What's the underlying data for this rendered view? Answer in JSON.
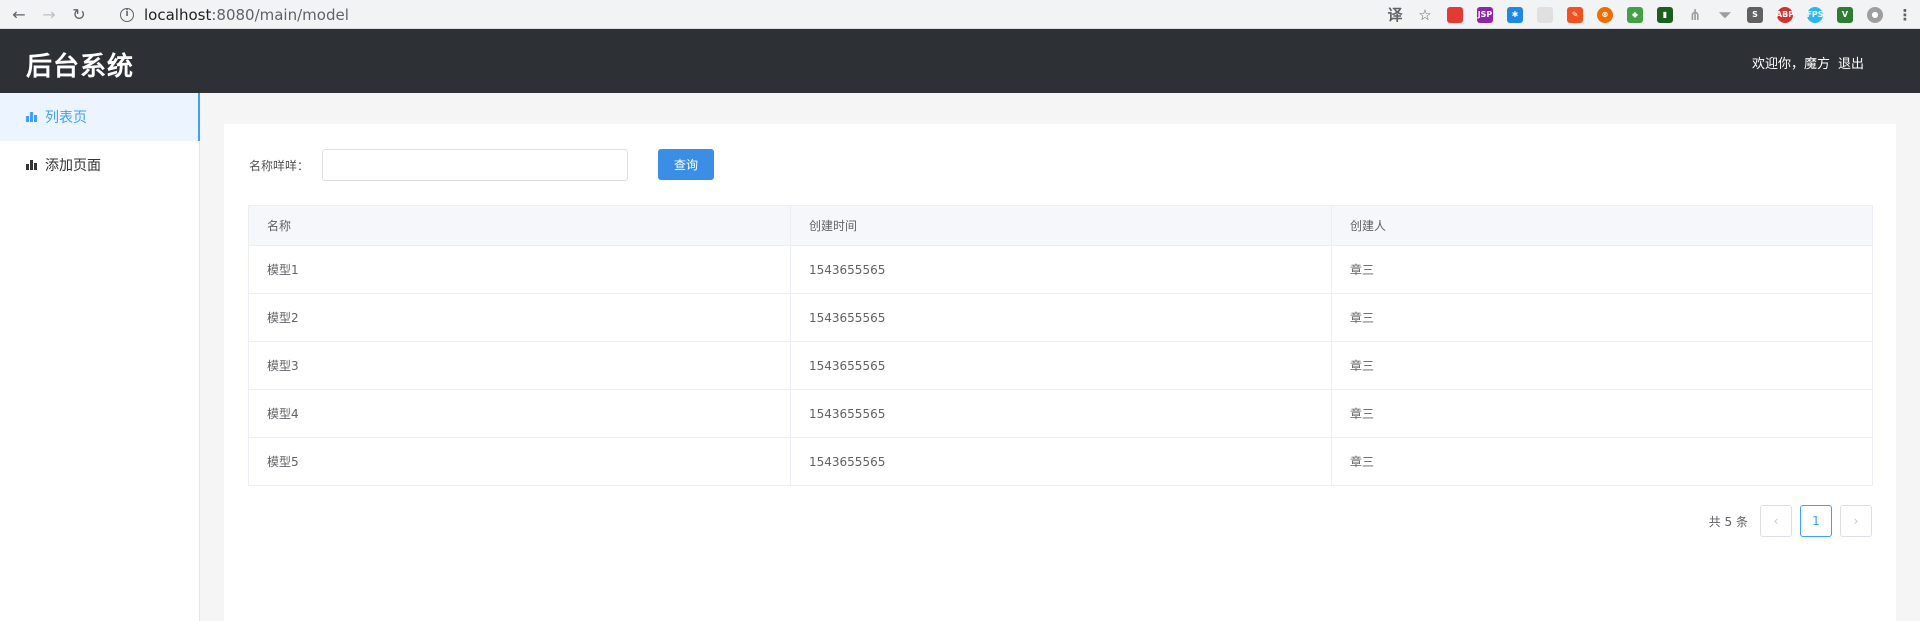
{
  "browser": {
    "url_host": "localhost",
    "url_path": ":8080/main/model",
    "extensions": [
      {
        "name": "translate-icon",
        "color": "#5f6368",
        "glyph": "译"
      },
      {
        "name": "star-icon",
        "color": "#5f6368",
        "glyph": "☆"
      },
      {
        "name": "ext-red-icon",
        "color": "#e53935",
        "glyph": ""
      },
      {
        "name": "ext-purple-icon",
        "color": "#8e24aa",
        "glyph": "JSP"
      },
      {
        "name": "ext-asterisk-icon",
        "color": "#1e88e5",
        "glyph": "✱"
      },
      {
        "name": "ext-blank-icon",
        "color": "#e0e0e0",
        "glyph": ""
      },
      {
        "name": "ext-orange-icon",
        "color": "#f4511e",
        "glyph": "✎"
      },
      {
        "name": "ext-orange-round-icon",
        "color": "#ef6c00",
        "glyph": "⊗"
      },
      {
        "name": "ext-green-icon",
        "color": "#43a047",
        "glyph": "◆"
      },
      {
        "name": "ext-dark-green-icon",
        "color": "#1b5e20",
        "glyph": "▮"
      },
      {
        "name": "ext-tree-icon",
        "color": "#9e9e9e",
        "glyph": "⋔"
      },
      {
        "name": "filter-icon",
        "color": "#9e9e9e",
        "glyph": "⏷"
      },
      {
        "name": "ext-s-icon",
        "color": "#616161",
        "glyph": "S"
      },
      {
        "name": "adblock-icon",
        "color": "#d32f2f",
        "glyph": "ABP"
      },
      {
        "name": "fps-icon",
        "color": "#29b6f6",
        "glyph": "FPS"
      },
      {
        "name": "vue-icon",
        "color": "#2e7d32",
        "glyph": "V"
      },
      {
        "name": "profile-icon",
        "color": "#9e9e9e",
        "glyph": "●"
      },
      {
        "name": "menu-dots-icon",
        "color": "#5f6368",
        "glyph": "⋮"
      }
    ]
  },
  "header": {
    "title": "后台系统",
    "welcome": "欢迎你，魔方",
    "logout": "退出"
  },
  "sidebar": {
    "items": [
      {
        "label": "列表页",
        "active": true
      },
      {
        "label": "添加页面",
        "active": false
      }
    ]
  },
  "search": {
    "label": "名称咩咩：",
    "value": "",
    "placeholder": "",
    "button": "查询"
  },
  "table": {
    "columns": [
      "名称",
      "创建时间",
      "创建人"
    ],
    "rows": [
      [
        "模型1",
        "1543655565",
        "章三"
      ],
      [
        "模型2",
        "1543655565",
        "章三"
      ],
      [
        "模型3",
        "1543655565",
        "章三"
      ],
      [
        "模型4",
        "1543655565",
        "章三"
      ],
      [
        "模型5",
        "1543655565",
        "章三"
      ]
    ]
  },
  "pagination": {
    "total": "共 5 条",
    "current_page": "1",
    "prev": "‹",
    "next": "›"
  }
}
